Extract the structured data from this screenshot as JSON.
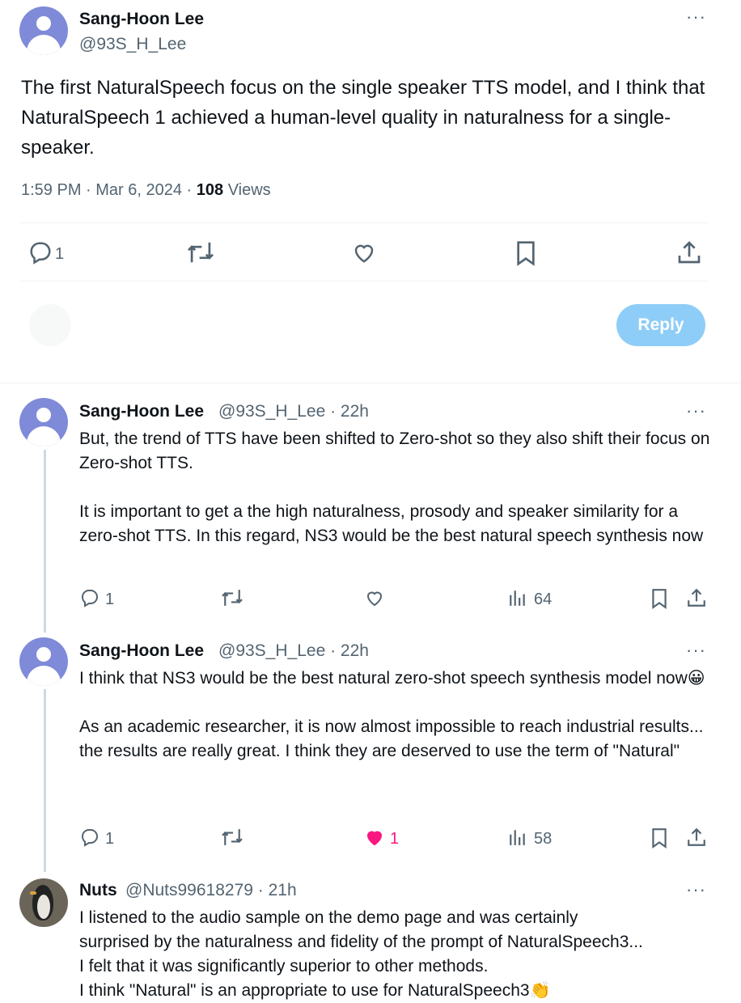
{
  "main_tweet": {
    "author_name": "Sang-Hoon Lee",
    "author_handle": "@93S_H_Lee",
    "text": "The first NaturalSpeech focus on the single speaker TTS model, and I think that NaturalSpeech 1 achieved a human-level quality in naturalness for a single-speaker.",
    "time": "1:59 PM · Mar 6, 2024 · ",
    "views_count": "108",
    "views_label": " Views",
    "reply_count": "1"
  },
  "compose": {
    "reply_button": "Reply"
  },
  "replies": [
    {
      "author_name": "Sang-Hoon Lee",
      "author_handle": "@93S_H_Lee · 22h",
      "paragraph1": "But, the trend of TTS have been shifted to Zero-shot so they also shift their focus on Zero-shot TTS.",
      "paragraph2": "It is important to get a the high naturalness, prosody and speaker similarity for a zero-shot TTS.  In this regard, NS3 would be the best natural speech synthesis now",
      "reply_count": "1",
      "views": "64"
    },
    {
      "author_name": "Sang-Hoon Lee",
      "author_handle": "@93S_H_Lee · 22h",
      "paragraph1": "I think that NS3 would be the best natural zero-shot speech synthesis model now😀",
      "paragraph2": "As an academic researcher, it is now almost impossible to reach industrial results... the results are really great. I think they are deserved to use the term of \"Natural\"",
      "reply_count": "1",
      "like_count": "1",
      "views": "58"
    },
    {
      "author_name": "Nuts",
      "author_handle": "@Nuts99618279 · 21h",
      "line1": "I listened to the audio sample on the demo page and was certainly",
      "line2": "surprised by the naturalness and fidelity of the prompt of NaturalSpeech3...",
      "line3": "I felt that it was significantly superior to other methods.",
      "line4": "I think \"Natural\" is an appropriate to use for NaturalSpeech3👏"
    }
  ],
  "icons": {
    "more": "more-icon",
    "reply": "reply-icon",
    "retweet": "retweet-icon",
    "like": "heart-icon",
    "bookmark": "bookmark-icon",
    "share": "share-icon",
    "views": "views-icon"
  },
  "colors": {
    "accent": "#1d9bf0",
    "reply_button": "#8ecdf7",
    "like": "#f91880",
    "muted": "#536471",
    "avatar": "#7f8ad8"
  }
}
